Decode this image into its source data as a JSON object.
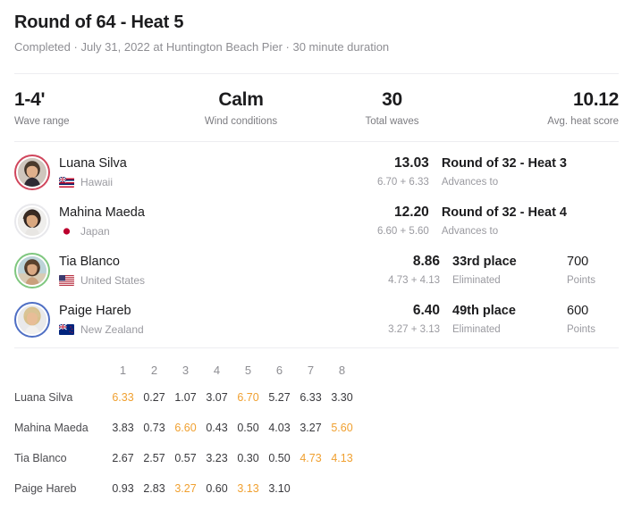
{
  "header": {
    "title": "Round of 64 - Heat 5",
    "status": "Completed",
    "sep1": " · ",
    "datetime": "July 31, 2022 at Huntington Beach Pier",
    "sep2": " · ",
    "duration": "30 minute duration"
  },
  "stats": [
    {
      "value": "1-4'",
      "label": "Wave range"
    },
    {
      "value": "Calm",
      "label": "Wind conditions"
    },
    {
      "value": "30",
      "label": "Total waves"
    },
    {
      "value": "10.12",
      "label": "Avg. heat score"
    }
  ],
  "athletes": [
    {
      "name": "Luana Silva",
      "country": "Hawaii",
      "flag": "hawaii-flag-icon",
      "ring_color": "#d0465c",
      "total": "13.03",
      "breakdown": "6.70 + 6.33",
      "status_main": "Round of 32 - Heat 3",
      "status_sub": "Advances to",
      "points": "",
      "points_label": ""
    },
    {
      "name": "Mahina Maeda",
      "country": "Japan",
      "flag": "japan-flag-icon",
      "ring_color": "#e8e8ec",
      "total": "12.20",
      "breakdown": "6.60 + 5.60",
      "status_main": "Round of 32 - Heat 4",
      "status_sub": "Advances to",
      "points": "",
      "points_label": ""
    },
    {
      "name": "Tia Blanco",
      "country": "United States",
      "flag": "usa-flag-icon",
      "ring_color": "#7fc77f",
      "total": "8.86",
      "breakdown": "4.73 + 4.13",
      "status_main": "33rd place",
      "status_sub": "Eliminated",
      "points": "700",
      "points_label": "Points"
    },
    {
      "name": "Paige Hareb",
      "country": "New Zealand",
      "flag": "newzealand-flag-icon",
      "ring_color": "#4f6fc4",
      "total": "6.40",
      "breakdown": "3.27 + 3.13",
      "status_main": "49th place",
      "status_sub": "Eliminated",
      "points": "600",
      "points_label": "Points"
    }
  ],
  "wave_table": {
    "columns": [
      "1",
      "2",
      "3",
      "4",
      "5",
      "6",
      "7",
      "8"
    ],
    "highlight_color": "#f0a030",
    "rows": [
      {
        "name": "Luana Silva",
        "scores": [
          "6.33",
          "0.27",
          "1.07",
          "3.07",
          "6.70",
          "5.27",
          "6.33",
          "3.30"
        ],
        "best_indices": [
          0,
          4
        ]
      },
      {
        "name": "Mahina Maeda",
        "scores": [
          "3.83",
          "0.73",
          "6.60",
          "0.43",
          "0.50",
          "4.03",
          "3.27",
          "5.60"
        ],
        "best_indices": [
          2,
          7
        ]
      },
      {
        "name": "Tia Blanco",
        "scores": [
          "2.67",
          "2.57",
          "0.57",
          "3.23",
          "0.30",
          "0.50",
          "4.73",
          "4.13"
        ],
        "best_indices": [
          6,
          7
        ]
      },
      {
        "name": "Paige Hareb",
        "scores": [
          "0.93",
          "2.83",
          "3.27",
          "0.60",
          "3.13",
          "3.10",
          "",
          ""
        ],
        "best_indices": [
          2,
          4
        ]
      }
    ]
  }
}
